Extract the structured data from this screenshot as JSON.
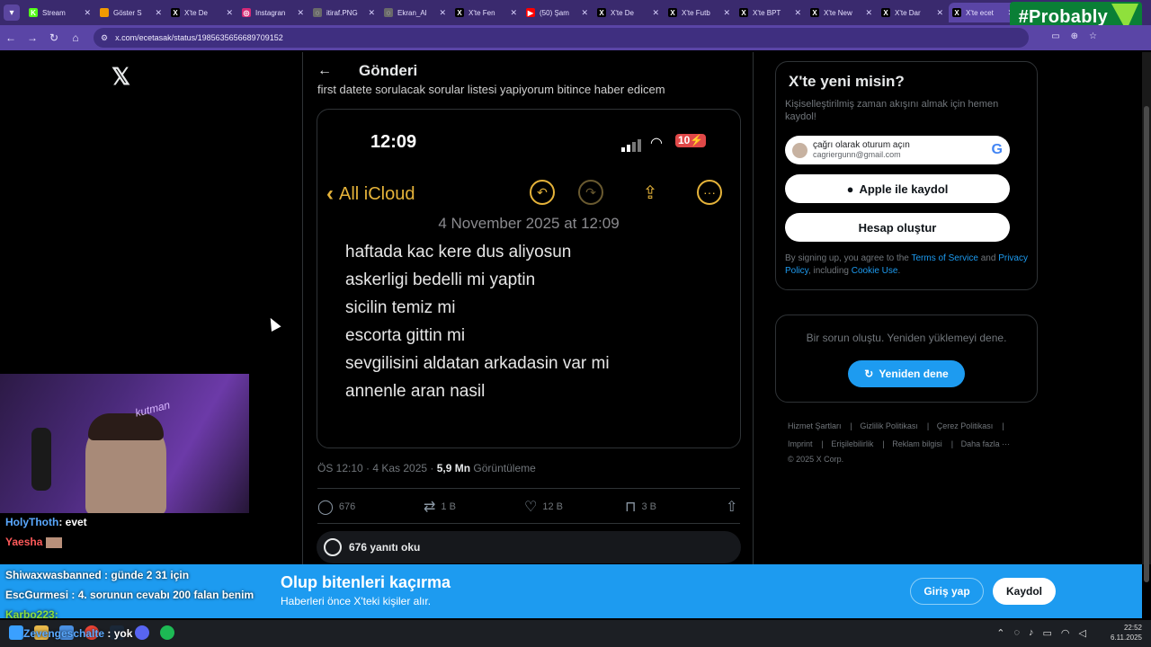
{
  "browser": {
    "tabs": [
      {
        "title": "Stream",
        "fav": "K",
        "color": "#53fc18"
      },
      {
        "title": "Göster S",
        "fav": "",
        "color": "#f29900"
      },
      {
        "title": "X'te De",
        "fav": "X",
        "color": "#000000"
      },
      {
        "title": "Instagran",
        "fav": "◎",
        "color": "#d62976"
      },
      {
        "title": "itiraf.PNG",
        "fav": "◌",
        "color": "#6a6a6a"
      },
      {
        "title": "Ekran_Al",
        "fav": "◌",
        "color": "#6a6a6a"
      },
      {
        "title": "X'te Fen",
        "fav": "X",
        "color": "#000000"
      },
      {
        "title": "(50) Şam",
        "fav": "▶",
        "color": "#ff0000"
      },
      {
        "title": "X'te De",
        "fav": "X",
        "color": "#000000"
      },
      {
        "title": "X'te Futb",
        "fav": "X",
        "color": "#000000"
      },
      {
        "title": "X'te BPT",
        "fav": "X",
        "color": "#000000"
      },
      {
        "title": "X'te New",
        "fav": "X",
        "color": "#000000"
      },
      {
        "title": "X'te Dar",
        "fav": "X",
        "color": "#000000"
      },
      {
        "title": "X'te ecet",
        "fav": "X",
        "color": "#000000",
        "active": true
      }
    ],
    "url": "x.com/ecetasak/status/1985635656689709152",
    "overlay_badge": "#Probably"
  },
  "post": {
    "header_title": "Gönderi",
    "text": "first datete sorulacak sorular listesi yapiyorum bitince haber edicem",
    "phone": {
      "time": "12:09",
      "battery": "10",
      "back_label": "All iCloud",
      "note_date": "4 November 2025 at 12:09",
      "note_lines": [
        "haftada kac kere dus aliyosun",
        "askerligi bedelli mi yaptin",
        "sicilin temiz mi",
        "escorta gittin mi",
        "sevgilisini aldatan arkadasin var mi",
        "annenle aran nasil"
      ]
    },
    "meta_time": "ÖS 12:10 · 4 Kas 2025 · ",
    "views_count": "5,9 Mn",
    "views_label": " Görüntüleme",
    "actions": {
      "replies": "676",
      "reposts": "1 B",
      "likes": "12 B",
      "bookmarks": "3 B"
    },
    "read_replies": "676 yanıtı oku"
  },
  "sidebar": {
    "new_title": "X'te yeni misin?",
    "new_sub": "Kişiselleştirilmiş zaman akışını almak için hemen kaydol!",
    "google_name": "çağrı olarak oturum açın",
    "google_email": "cagriergunn@gmail.com",
    "apple_label": "Apple ile kaydol",
    "create_label": "Hesap oluştur",
    "legal_1": "By signing up, you agree to the ",
    "legal_tos": "Terms of Service",
    "legal_2": " and ",
    "legal_privacy": "Privacy Policy",
    "legal_3": ", including ",
    "legal_cookie": "Cookie Use",
    "legal_4": ".",
    "error_text": "Bir sorun oluştu. Yeniden yüklemeyi dene.",
    "retry_label": "Yeniden dene",
    "footer": {
      "terms": "Hizmet Şartları",
      "privacy": "Gizlilik Politikası",
      "cookies": "Çerez Politikası",
      "imprint": "Imprint",
      "accessibility": "Erişilebilirlik",
      "ads": "Reklam bilgisi",
      "more": "Daha fazla ···",
      "copyright": "© 2025 X Corp."
    }
  },
  "banner": {
    "title": "Olup bitenleri kaçırma",
    "subtitle": "Haberleri önce X'teki kişiler alır.",
    "login": "Giriş yap",
    "signup": "Kaydol"
  },
  "stream": {
    "webcam_neon": "kutman",
    "chat": [
      {
        "user": "HolyThoth",
        "msg": ": evet"
      },
      {
        "user": "Yaesha",
        "msg": ""
      },
      {
        "user": "Shiwaxwasbanned",
        "msg": " : günde 2 31 için"
      },
      {
        "user": "EscGurmesi",
        "msg": " : 4. sorunun cevabı 200 falan benim"
      },
      {
        "user": "Karbo223",
        "msg": ":"
      },
      {
        "user": "Zevengeschalte",
        "msg": " : yok"
      }
    ]
  },
  "taskbar": {
    "time": "22:52",
    "date": "6.11.2025"
  }
}
